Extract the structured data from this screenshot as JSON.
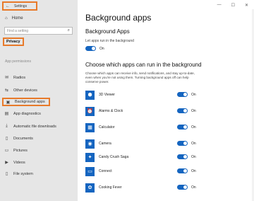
{
  "window": {
    "title": "Settings"
  },
  "sidebar": {
    "back_glyph": "←",
    "home": {
      "icon": "⌂",
      "label": "Home"
    },
    "search": {
      "placeholder": "Find a setting",
      "icon": "⌕"
    },
    "privacy_label": "Privacy",
    "section_label": "App permissions",
    "items": [
      {
        "icon": "✉",
        "label": "Radios"
      },
      {
        "icon": "⇆",
        "label": "Other devices"
      },
      {
        "icon": "▣",
        "label": "Background apps",
        "active": true
      },
      {
        "icon": "▤",
        "label": "App diagnostics"
      },
      {
        "icon": "⤓",
        "label": "Automatic file downloads"
      },
      {
        "icon": "▯",
        "label": "Documents"
      },
      {
        "icon": "▭",
        "label": "Pictures"
      },
      {
        "icon": "▶",
        "label": "Videos"
      },
      {
        "icon": "▯",
        "label": "File system"
      }
    ]
  },
  "window_controls": {
    "minimize": "—",
    "maximize": "☐",
    "close": "✕"
  },
  "main": {
    "title": "Background apps",
    "subtitle": "Background Apps",
    "let_apps_label": "Let apps run in the background",
    "master_toggle": "On",
    "choose_heading": "Choose which apps can run in the background",
    "description": "Choose which apps can receive info, send notifications, and stay up-to-date, even when you're not using them. Turning background apps off can help conserve power.",
    "apps": [
      {
        "icon": "⬢",
        "name": "3D Viewer",
        "state": "On"
      },
      {
        "icon": "⏰",
        "name": "Alarms & Clock",
        "state": "On"
      },
      {
        "icon": "▦",
        "name": "Calculator",
        "state": "On"
      },
      {
        "icon": "◉",
        "name": "Camera",
        "state": "On"
      },
      {
        "icon": "✦",
        "name": "Candy Crush Saga",
        "state": "On"
      },
      {
        "icon": "▭",
        "name": "Connect",
        "state": "On"
      },
      {
        "icon": "✿",
        "name": "Cooking Fever",
        "state": "On"
      }
    ]
  },
  "colors": {
    "accent": "#1565c0",
    "highlight": "#e87a2a",
    "sidebar_bg": "#e6e6e6"
  }
}
